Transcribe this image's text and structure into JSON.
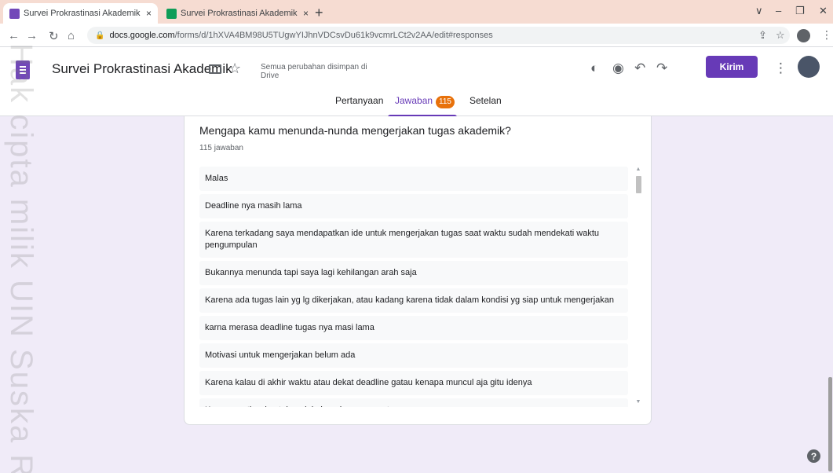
{
  "browser": {
    "tabs": [
      {
        "title": "Survei Prokrastinasi Akademik - G",
        "close": "×"
      },
      {
        "title": "Survei Prokrastinasi Akademik (Je",
        "close": "×"
      }
    ],
    "new_tab": "+",
    "window_controls": [
      "∨",
      "–",
      "❐",
      "✕"
    ],
    "url_host": "docs.google.com",
    "url_path": "/forms/d/1hXVA4BM98U5TUgwYIJhnVDCsvDu61k9vcmrLCt2v2AA/edit#responses"
  },
  "header": {
    "title": "Survei Prokrastinasi Akademik",
    "save_status": "Semua perubahan disimpan di Drive",
    "send_label": "Kirim"
  },
  "tabs": {
    "questions": "Pertanyaan",
    "responses": "Jawaban",
    "responses_count": "115",
    "settings": "Setelan"
  },
  "question": {
    "title": "Mengapa kamu menunda-nunda mengerjakan tugas akademik?",
    "count": "115 jawaban",
    "answers": [
      "Malas",
      "Deadline nya masih lama",
      "Karena terkadang saya mendapatkan ide untuk mengerjakan tugas saat waktu sudah mendekati waktu pengumpulan",
      "Bukannya menunda tapi saya lagi kehilangan arah saja",
      "Karena ada tugas lain yg lg dikerjakan, atau kadang karena tidak dalam kondisi yg siap untuk mengerjakan",
      "karna merasa deadline tugas nya masi lama",
      "Motivasi untuk mengerjakan belum ada",
      "Karena kalau di akhir waktu atau dekat deadline gatau kenapa muncul aja gitu idenya",
      "Kurang motivasi untuk melakukan dengan cepat"
    ]
  },
  "watermark": "Hak cipta milik UIN Suska Ria",
  "help": "?",
  "colors": {
    "brand": "#673ab7",
    "badge": "#e8710a",
    "background": "#f0ebf8"
  }
}
